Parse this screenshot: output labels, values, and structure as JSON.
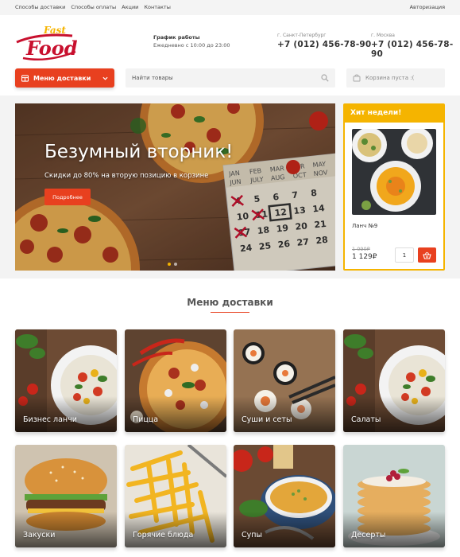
{
  "topbar": {
    "links": [
      "Способы доставки",
      "Способы оплаты",
      "Акции",
      "Контакты"
    ],
    "auth": "Авторизация"
  },
  "logo": {
    "top_word": "Fast",
    "main_word": "Food"
  },
  "schedule": {
    "title": "График работы",
    "hours": "Ежедневно с 10:00 до 23:00"
  },
  "contacts": [
    {
      "city": "г. Санкт-Петербург",
      "phone": "+7 (012) 456-78-90"
    },
    {
      "city": "г. Москва",
      "phone": "+7 (012) 456-78-90"
    }
  ],
  "menu_button": {
    "label": "Меню доставки"
  },
  "search": {
    "placeholder": "Найти товары"
  },
  "cart": {
    "label": "Корзина пуста :("
  },
  "hero": {
    "title": "Безумный вторник!",
    "subtitle": "Скидки до 80% на вторую позицию в корзине",
    "button": "Подробнее",
    "slides": 2,
    "active_slide": 1
  },
  "hit": {
    "heading": "Хит недели!",
    "product_name": "Ланч №9",
    "old_price": "1 090₽",
    "price": "1 129₽",
    "quantity": "1"
  },
  "menu": {
    "heading": "Меню доставки",
    "categories": [
      "Бизнес ланчи",
      "Пицца",
      "Суши и сеты",
      "Салаты",
      "Закуски",
      "Горячие блюда",
      "Супы",
      "Десерты"
    ]
  },
  "colors": {
    "accent": "#e8401f",
    "highlight": "#f5b400"
  }
}
